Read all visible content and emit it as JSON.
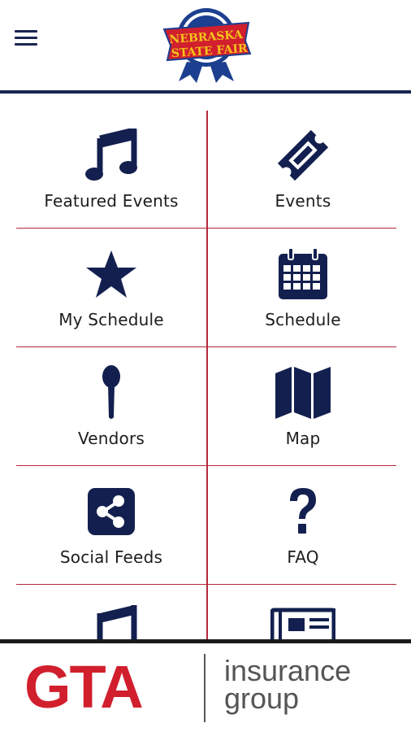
{
  "header": {
    "menu_icon": "hamburger-menu-icon",
    "logo": {
      "line1": "NEBRASKA",
      "line2": "STATE FAIR",
      "colors": {
        "ribbon": "#1d3f8f",
        "banner": "#d11f2d",
        "text": "#f3c41a"
      }
    }
  },
  "colors": {
    "icon": "#13204f",
    "divider": "#b6283a",
    "rule": "#1b2550"
  },
  "menu": {
    "items": [
      {
        "label": "Featured Events",
        "icon": "music-note-icon"
      },
      {
        "label": "Events",
        "icon": "ticket-icon"
      },
      {
        "label": "My Schedule",
        "icon": "star-icon"
      },
      {
        "label": "Schedule",
        "icon": "calendar-icon"
      },
      {
        "label": "Vendors",
        "icon": "spoon-icon"
      },
      {
        "label": "Map",
        "icon": "map-icon"
      },
      {
        "label": "Social Feeds",
        "icon": "share-icon"
      },
      {
        "label": "FAQ",
        "icon": "question-icon"
      },
      {
        "label": "",
        "icon": "music-note-icon"
      },
      {
        "label": "",
        "icon": "newspaper-icon"
      }
    ]
  },
  "footer": {
    "brand": "GTA",
    "tagline_line1": "insurance",
    "tagline_line2": "group"
  }
}
